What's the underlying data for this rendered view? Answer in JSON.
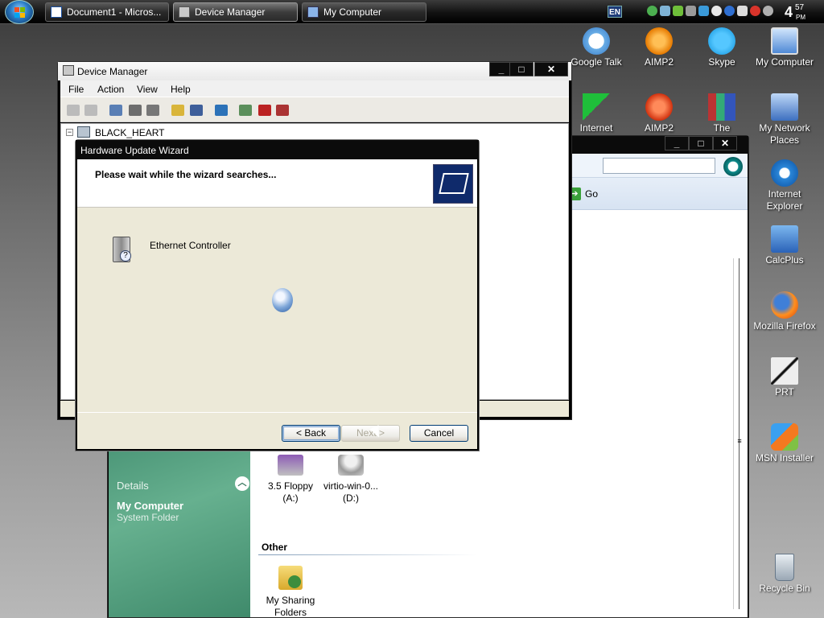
{
  "taskbar": {
    "buttons": [
      {
        "label": "Document1 - Micros..."
      },
      {
        "label": "Device Manager"
      },
      {
        "label": "My Computer"
      }
    ],
    "language": "EN",
    "clock": {
      "hour": "4",
      "minute": "57",
      "ampm": "PM"
    }
  },
  "desktop_icons": [
    {
      "label": "Google Talk"
    },
    {
      "label": "AIMP2"
    },
    {
      "label": "Skype"
    },
    {
      "label": "My Computer"
    },
    {
      "label": "Internet"
    },
    {
      "label": "AIMP2"
    },
    {
      "label": "The"
    },
    {
      "label": "My Network Places"
    },
    {
      "label": "Internet Explorer"
    },
    {
      "label": "CalcPlus"
    },
    {
      "label": "Mozilla Firefox"
    },
    {
      "label": "PRT"
    },
    {
      "label": "MSN Installer"
    },
    {
      "label": "Recycle Bin"
    }
  ],
  "device_manager": {
    "title": "Device Manager",
    "menu": [
      "File",
      "Action",
      "View",
      "Help"
    ],
    "tree_root": "BLACK_HEART"
  },
  "my_computer": {
    "address_go": "Go",
    "details": {
      "heading": "Details",
      "title": "My Computer",
      "subtitle": "System Folder"
    },
    "drives": [
      {
        "label": "3.5 Floppy",
        "sub": "(A:)"
      },
      {
        "label": "virtio-win-0...",
        "sub": "(D:)"
      }
    ],
    "other_heading": "Other",
    "other_items": [
      {
        "label": "My Sharing",
        "sub": "Folders"
      }
    ]
  },
  "wizard": {
    "title": "Hardware Update Wizard",
    "header_text": "Please wait while the wizard searches...",
    "device": "Ethernet Controller",
    "buttons": {
      "back": "< Back",
      "next": "Next >",
      "cancel": "Cancel"
    }
  }
}
